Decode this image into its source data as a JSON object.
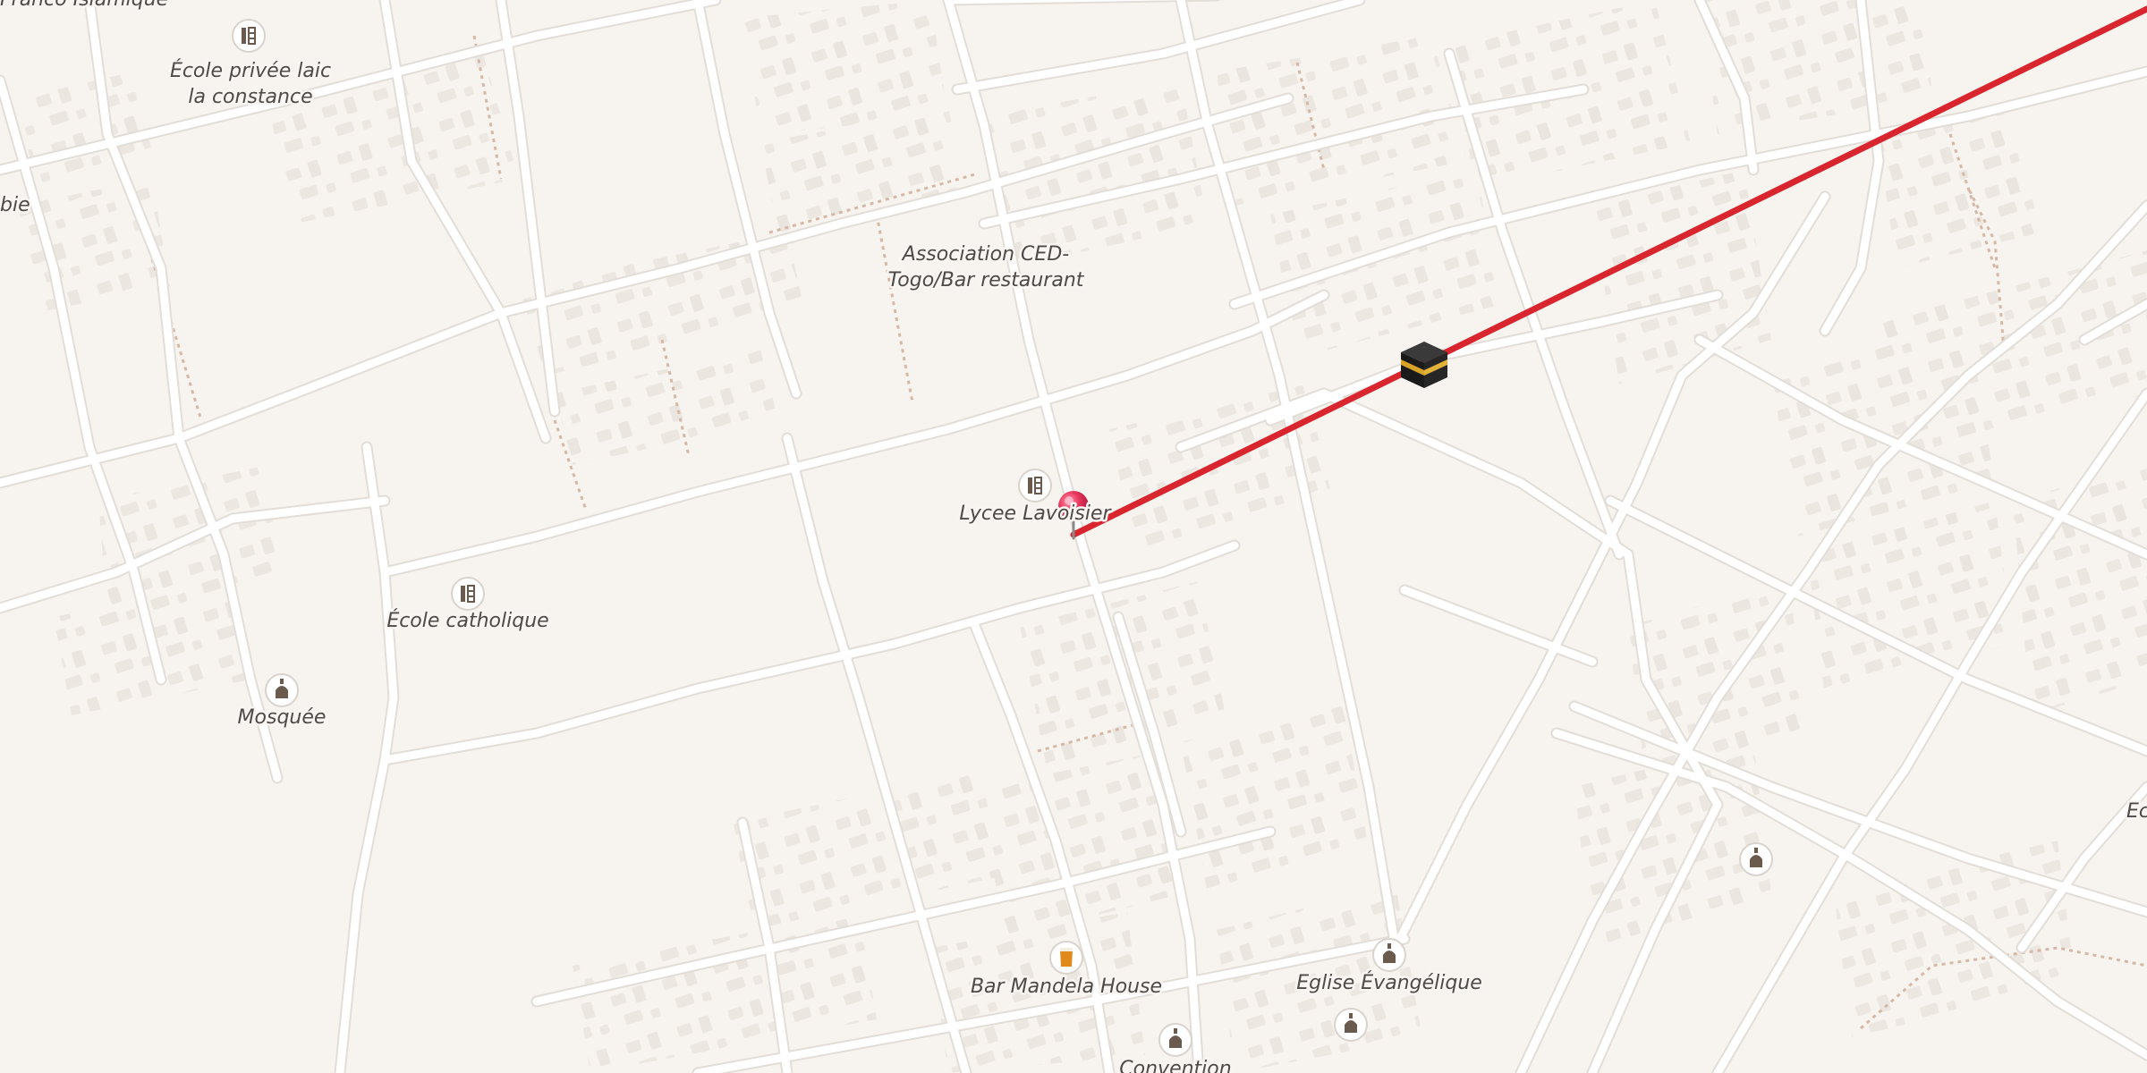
{
  "map": {
    "labels": {
      "lycee": "Lycee Lavoisier",
      "ecole_privee_line1": "École privée laic",
      "ecole_privee_line2": "la constance",
      "association_line1": "Association CED-",
      "association_line2": "Togo/Bar restaurant",
      "ecole_catholique": "École catholique",
      "mosquee": "Mosquée",
      "bar_mandela": "Bar Mandela House",
      "eglise": "Eglise Évangélique",
      "convention": "Convention",
      "franco_islamique": "Franco Islamique",
      "partial_left": "bie",
      "partial_right": "Ec"
    },
    "icons": {
      "school": "school-icon",
      "mosque": "mosque-icon",
      "church": "church-icon",
      "bar": "beer-icon",
      "pin": "location-pin-icon",
      "destination": "kaaba-icon"
    },
    "colors": {
      "background": "#f7f4f0",
      "road": "#ffffff",
      "road_casing": "#e2ddd7",
      "building": "#ebe5df",
      "qibla_line": "#d9262e",
      "pin": "#e8355b",
      "label_text": "#4d4a47"
    }
  }
}
